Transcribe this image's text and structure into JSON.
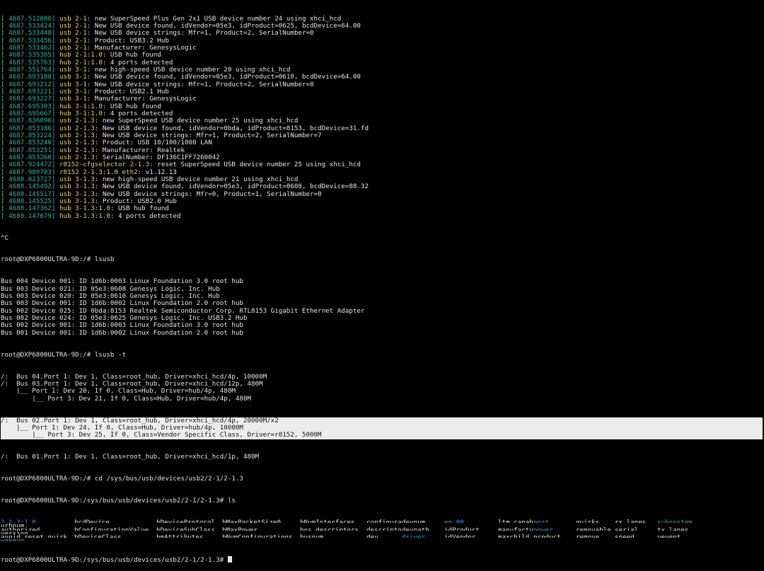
{
  "dmesg": [
    {
      "ts": "[ 4687.512080]",
      "dev": "usb 2-1:",
      "msg": " new SuperSpeed Plus Gen 2x1 USB device number 24 using xhci_hcd"
    },
    {
      "ts": "[ 4687.533424]",
      "dev": "usb 2-1:",
      "msg": " New USB device found, idVendor=05e3, idProduct=0625, bcdDevice=64.00"
    },
    {
      "ts": "[ 4687.533448]",
      "dev": "usb 2-1:",
      "msg": " New USB device strings: Mfr=1, Product=2, SerialNumber=0"
    },
    {
      "ts": "[ 4687.533456]",
      "dev": "usb 2-1:",
      "msg": " Product: USB3.2 Hub"
    },
    {
      "ts": "[ 4687.533462]",
      "dev": "usb 2-1:",
      "msg": " Manufacturer: GenesysLogic"
    },
    {
      "ts": "[ 4687.535365]",
      "dev": "hub 2-1:1.0:",
      "msg": " USB hub found"
    },
    {
      "ts": "[ 4687.535763]",
      "dev": "hub 2-1:1.0:",
      "msg": " 4 ports detected"
    },
    {
      "ts": "[ 4687.551764]",
      "dev": "usb 3-1:",
      "msg": " new high-speed USB device number 20 using xhci_hcd"
    },
    {
      "ts": "[ 4687.693188]",
      "dev": "usb 3-1:",
      "msg": " New USB device found, idVendor=05e3, idProduct=0610, bcdDevice=64.00"
    },
    {
      "ts": "[ 4687.693212]",
      "dev": "usb 3-1:",
      "msg": " New USB device strings: Mfr=1, Product=2, SerialNumber=0"
    },
    {
      "ts": "[ 4687.693221]",
      "dev": "usb 3-1:",
      "msg": " Product: USB2.1 Hub"
    },
    {
      "ts": "[ 4687.693227]",
      "dev": "usb 3-1:",
      "msg": " Manufacturer: GenesysLogic"
    },
    {
      "ts": "[ 4687.695303]",
      "dev": "hub 3-1:1.0:",
      "msg": " USB hub found"
    },
    {
      "ts": "[ 4687.695667]",
      "dev": "hub 3-1:1.0:",
      "msg": " 4 ports detected"
    },
    {
      "ts": "[ 4687.836090]",
      "dev": "usb 2-1.3:",
      "msg": " new SuperSpeed USB device number 25 using xhci_hcd"
    },
    {
      "ts": "[ 4687.853186]",
      "dev": "usb 2-1.3:",
      "msg": " New USB device found, idVendor=0bda, idProduct=8153, bcdDevice=31.fd"
    },
    {
      "ts": "[ 4687.853224]",
      "dev": "usb 2-1.3:",
      "msg": " New USB device strings: Mfr=1, Product=2, SerialNumber=7"
    },
    {
      "ts": "[ 4687.853240]",
      "dev": "usb 2-1.3:",
      "msg": " Product: USB 10/100/1000 LAN"
    },
    {
      "ts": "[ 4687.853251]",
      "dev": "usb 2-1.3:",
      "msg": " Manufacturer: Realtek"
    },
    {
      "ts": "[ 4687.853260]",
      "dev": "usb 2-1.3:",
      "msg": " SerialNumber: DF136C1FF7260042"
    },
    {
      "ts": "[ 4687.924472]",
      "dev": "r8152-cfgselector 2-1.3:",
      "msg": " reset SuperSpeed USB device number 25 using xhci_hcd"
    },
    {
      "ts": "[ 4687.989783]",
      "dev": "r8152 2-1.3:1.0 eth2:",
      "msg": " v1.12.13"
    },
    {
      "ts": "[ 4688.023727]",
      "dev": "usb 3-1.3:",
      "msg": " new high-speed USB device number 21 using xhci_hcd"
    },
    {
      "ts": "[ 4688.145492]",
      "dev": "usb 3-1.3:",
      "msg": " New USB device found, idVendor=05e3, idProduct=0608, bcdDevice=88.32"
    },
    {
      "ts": "[ 4688.145517]",
      "dev": "usb 3-1.3:",
      "msg": " New USB device strings: Mfr=0, Product=1, SerialNumber=0"
    },
    {
      "ts": "[ 4688.145525]",
      "dev": "usb 3-1.3:",
      "msg": " Product: USB2.0 Hub"
    },
    {
      "ts": "[ 4688.147362]",
      "dev": "hub 3-1.3:1.0:",
      "msg": " USB hub found"
    },
    {
      "ts": "[ 4688.147679]",
      "dev": "hub 3-1.3:1.0:",
      "msg": " 4 ports detected"
    }
  ],
  "ctrl_c": "^C",
  "cmd_lsusb": "root@DXP6800ULTRA-9D:/# lsusb",
  "lsusb": [
    "Bus 004 Device 001: ID 1d6b:0003 Linux Foundation 3.0 root hub",
    "Bus 003 Device 021: ID 05e3:0608 Genesys Logic, Inc. Hub",
    "Bus 003 Device 020: ID 05e3:0610 Genesys Logic, Inc. Hub",
    "Bus 003 Device 001: ID 1d6b:0002 Linux Foundation 2.0 root hub",
    "Bus 002 Device 025: ID 0bda:8153 Realtek Semiconductor Corp. RTL8153 Gigabit Ethernet Adapter",
    "Bus 002 Device 024: ID 05e3:0625 Genesys Logic, Inc. USB3.2 Hub",
    "Bus 002 Device 001: ID 1d6b:0003 Linux Foundation 3.0 root hub",
    "Bus 001 Device 001: ID 1d6b:0002 Linux Foundation 2.0 root hub"
  ],
  "cmd_lsusb_t": "root@DXP6800ULTRA-9D:/# lsusb -t",
  "tree_before": [
    "/:  Bus 04.Port 1: Dev 1, Class=root_hub, Driver=xhci_hcd/4p, 10000M",
    "/:  Bus 03.Port 1: Dev 1, Class=root_hub, Driver=xhci_hcd/12p, 480M",
    "    |__ Port 1: Dev 20, If 0, Class=Hub, Driver=hub/4p, 480M",
    "        |__ Port 3: Dev 21, If 0, Class=Hub, Driver=hub/4p, 480M"
  ],
  "tree_selected": [
    "/:  Bus 02.Port 1: Dev 1, Class=root_hub, Driver=xhci_hcd/4p, 20000M/x2",
    "    |__ Port 1: Dev 24, If 0, Class=Hub, Driver=hub/4p, 10000M",
    "        |__ Port 3: Dev 25, If 0, Class=Vendor Specific Class, Driver=r8152, 5000M"
  ],
  "tree_after": [
    "/:  Bus 01.Port 1: Dev 1, Class=root_hub, Driver=xhci_hcd/1p, 480M"
  ],
  "cmd_cd": "root@DXP6800ULTRA-9D:/# cd /sys/bus/usb/devices/usb2/2-1/2-1.3",
  "cmd_ls": "root@DXP6800ULTRA-9D:/sys/bus/usb/devices/usb2/2-1/2-1.3# ls",
  "ls_rows": [
    [
      {
        "t": "2-1.3:1.0",
        "c": "cyan"
      },
      {
        "t": "bcdDevice",
        "c": ""
      },
      {
        "t": "bDeviceProtocol",
        "c": ""
      },
      {
        "t": "bMaxPacketSize0",
        "c": ""
      },
      {
        "t": "bNumInterfaces",
        "c": ""
      },
      {
        "t": "configuration",
        "c": ""
      },
      {
        "t": "devnum",
        "c": ""
      },
      {
        "t": "ep_00",
        "c": "cyan"
      },
      {
        "t": "ltm_capable",
        "c": ""
      },
      {
        "t": "port",
        "c": "cyan"
      },
      {
        "t": "quirks",
        "c": ""
      },
      {
        "t": "rx_lanes",
        "c": ""
      },
      {
        "t": "subsystem",
        "c": "green"
      },
      {
        "t": "urbnum",
        "c": ""
      }
    ],
    [
      {
        "t": "authorized",
        "c": ""
      },
      {
        "t": "bConfigurationValue",
        "c": ""
      },
      {
        "t": "bDeviceSubClass",
        "c": ""
      },
      {
        "t": "bMaxPower",
        "c": ""
      },
      {
        "t": "bos_descriptors",
        "c": ""
      },
      {
        "t": "descriptors",
        "c": ""
      },
      {
        "t": "devpath",
        "c": ""
      },
      {
        "t": "idProduct",
        "c": ""
      },
      {
        "t": "manufacturer",
        "c": ""
      },
      {
        "t": "power",
        "c": "cyan"
      },
      {
        "t": "removable",
        "c": ""
      },
      {
        "t": "serial",
        "c": ""
      },
      {
        "t": "tx_lanes",
        "c": ""
      },
      {
        "t": "version",
        "c": ""
      }
    ],
    [
      {
        "t": "avoid_reset_quirk",
        "c": ""
      },
      {
        "t": "bDeviceClass",
        "c": ""
      },
      {
        "t": "bmAttributes",
        "c": ""
      },
      {
        "t": "bNumConfigurations",
        "c": ""
      },
      {
        "t": "busnum",
        "c": ""
      },
      {
        "t": "dev",
        "c": ""
      },
      {
        "t": "driver",
        "c": "cyan"
      },
      {
        "t": "idVendor",
        "c": ""
      },
      {
        "t": "maxchild",
        "c": ""
      },
      {
        "t": "product",
        "c": ""
      },
      {
        "t": "remove",
        "c": ""
      },
      {
        "t": "speed",
        "c": ""
      },
      {
        "t": "uevent",
        "c": ""
      },
      {
        "t": "wakeup",
        "c": "cyan"
      }
    ]
  ],
  "final_prompt": "root@DXP6800ULTRA-9D:/sys/bus/usb/devices/usb2/2-1/2-1.3# "
}
